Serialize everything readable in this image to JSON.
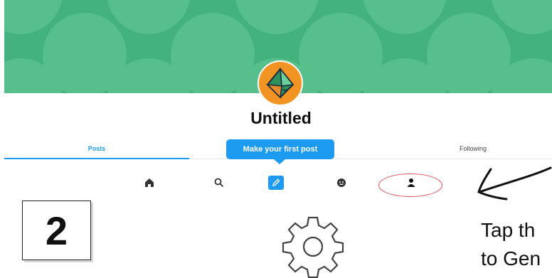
{
  "profile": {
    "name": "Untitled"
  },
  "tabs": [
    {
      "label": "Posts",
      "active": true
    },
    {
      "label": "Following",
      "active": false
    }
  ],
  "tooltip": {
    "text": "Make your first post"
  },
  "navbar": {
    "items": [
      {
        "icon": "home-icon"
      },
      {
        "icon": "search-icon"
      },
      {
        "icon": "pencil-icon",
        "highlighted": true
      },
      {
        "icon": "smiley-icon"
      },
      {
        "icon": "person-icon",
        "circled": true
      }
    ]
  },
  "step": {
    "number": "2"
  },
  "instruction": {
    "line1": "Tap th",
    "line2": "to Gen"
  },
  "colors": {
    "banner": "#44b27c",
    "accent": "#1d9bf0",
    "avatar_bg": "#f29424",
    "highlight_ring": "#e0505a"
  }
}
